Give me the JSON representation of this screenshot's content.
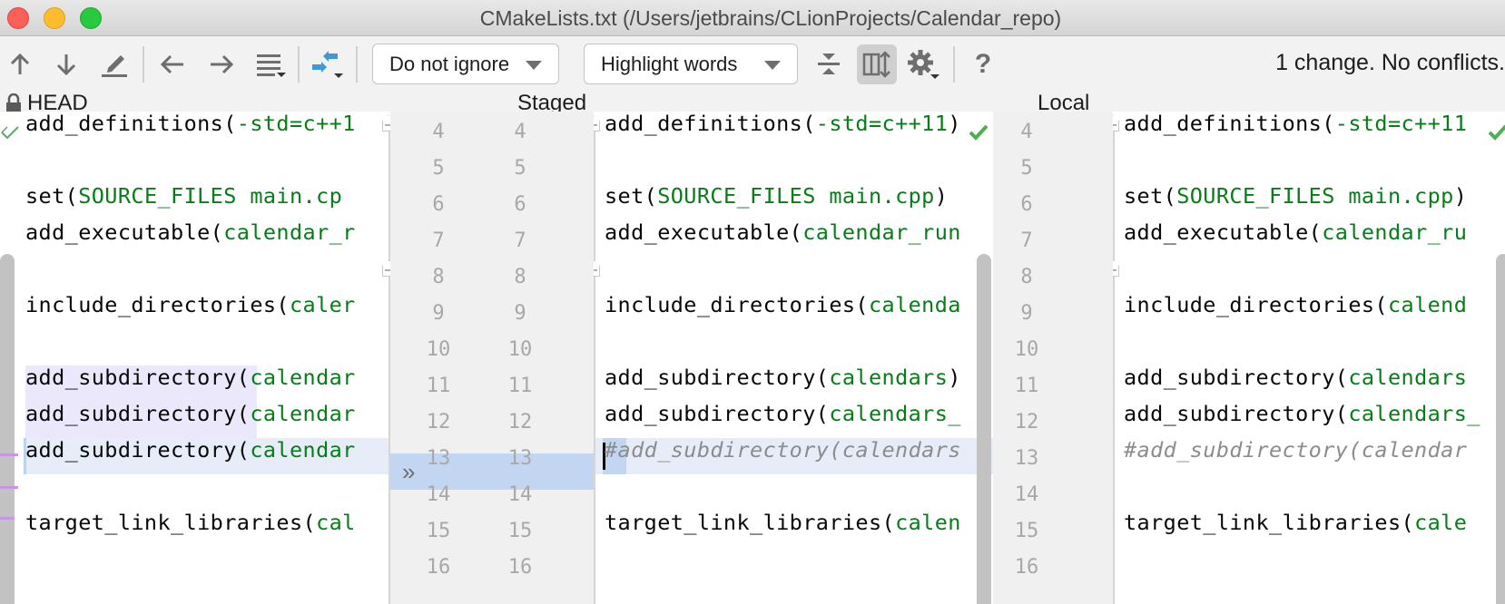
{
  "window": {
    "title": "CMakeLists.txt (/Users/jetbrains/CLionProjects/Calendar_repo)"
  },
  "toolbar": {
    "icons": {
      "prev_change": "arrow-up-icon",
      "next_change": "arrow-down-icon",
      "edit": "pencil-icon",
      "prev_file": "arrow-left-icon",
      "next_file": "arrow-right-icon",
      "menu": "list-menu-icon",
      "apply_non_conflicting": "merge-arrows-icon",
      "collapse": "collapse-unchanged-icon",
      "sync_scroll": "sync-scroll-icon",
      "settings": "gear-icon",
      "help": "question-icon"
    },
    "ignore_dropdown": "Do not ignore",
    "highlight_dropdown": "Highlight words",
    "help_label": "?",
    "status": "1 change. No conflicts."
  },
  "panes": {
    "left": {
      "label": "HEAD",
      "locked": true
    },
    "middle": {
      "label": "Staged"
    },
    "right": {
      "label": "Local"
    }
  },
  "line_numbers": {
    "left": [
      "4",
      "5",
      "6",
      "7",
      "8",
      "9",
      "10",
      "11",
      "12",
      "13",
      "14",
      "15",
      "16"
    ],
    "middle": [
      "4",
      "5",
      "6",
      "7",
      "8",
      "9",
      "10",
      "11",
      "12",
      "13",
      "14",
      "15",
      "16"
    ],
    "right": [
      "4",
      "5",
      "6",
      "7",
      "8",
      "9",
      "10",
      "11",
      "12",
      "13",
      "14",
      "15",
      "16"
    ]
  },
  "code": {
    "head": [
      {
        "fn": "add_definitions(",
        "arg": "-std=c++1"
      },
      {
        "fn": "",
        "arg": ""
      },
      {
        "fn": "set(",
        "arg": "SOURCE_FILES main.cp"
      },
      {
        "fn": "add_executable(",
        "arg": "calendar_r"
      },
      {
        "fn": "",
        "arg": ""
      },
      {
        "fn": "include_directories(",
        "arg": "caler"
      },
      {
        "fn": "",
        "arg": ""
      },
      {
        "fn": "add_subdirectory",
        "paren": "(",
        "arg": "calendar"
      },
      {
        "fn": "add_subdirectory",
        "paren": "(",
        "arg": "calendar"
      },
      {
        "fn": "add_subdirectory(",
        "arg": "calendar"
      },
      {
        "fn": "",
        "arg": ""
      },
      {
        "fn": "target_link_libraries(",
        "arg": "cal"
      },
      {
        "fn": "",
        "arg": ""
      }
    ],
    "staged": [
      {
        "fn": "add_definitions(",
        "arg": "-std=c++11",
        "tail": ")"
      },
      {
        "fn": "",
        "arg": ""
      },
      {
        "fn": "set(",
        "arg": "SOURCE_FILES main.cpp",
        "tail": ")"
      },
      {
        "fn": "add_executable(",
        "arg": "calendar_run"
      },
      {
        "fn": "",
        "arg": ""
      },
      {
        "fn": "include_directories(",
        "arg": "calenda"
      },
      {
        "fn": "",
        "arg": ""
      },
      {
        "fn": "add_subdirectory(",
        "arg": "calendars",
        "tail": ")"
      },
      {
        "fn": "add_subdirectory(",
        "arg": "calendars_"
      },
      {
        "comment": "#add_subdirectory(calendars"
      },
      {
        "fn": "",
        "arg": ""
      },
      {
        "fn": "target_link_libraries(",
        "arg": "calen"
      },
      {
        "fn": "",
        "arg": ""
      }
    ],
    "local": [
      {
        "fn": "add_definitions(",
        "arg": "-std=c++11"
      },
      {
        "fn": "",
        "arg": ""
      },
      {
        "fn": "set(",
        "arg": "SOURCE_FILES main.cpp",
        "tail": ")"
      },
      {
        "fn": "add_executable(",
        "arg": "calendar_ru"
      },
      {
        "fn": "",
        "arg": ""
      },
      {
        "fn": "include_directories(",
        "arg": "calend"
      },
      {
        "fn": "",
        "arg": ""
      },
      {
        "fn": "add_subdirectory(",
        "arg": "calendars"
      },
      {
        "fn": "add_subdirectory(",
        "arg": "calendars_"
      },
      {
        "comment": "#add_subdirectory(calendar"
      },
      {
        "fn": "",
        "arg": ""
      },
      {
        "fn": "target_link_libraries(",
        "arg": "cale"
      },
      {
        "fn": "",
        "arg": ""
      }
    ]
  },
  "gutter": {
    "apply_change_icon": "double-chevron-right-icon",
    "apply_change_glyph": "»",
    "no_conflict_icon": "check-icon"
  },
  "colors": {
    "string_green": "#067d17",
    "change_highlight": "#c3d6f1",
    "change_row": "#e6edf9",
    "word_highlight": "#ebe8fb",
    "marker_purple": "#c795e8"
  }
}
